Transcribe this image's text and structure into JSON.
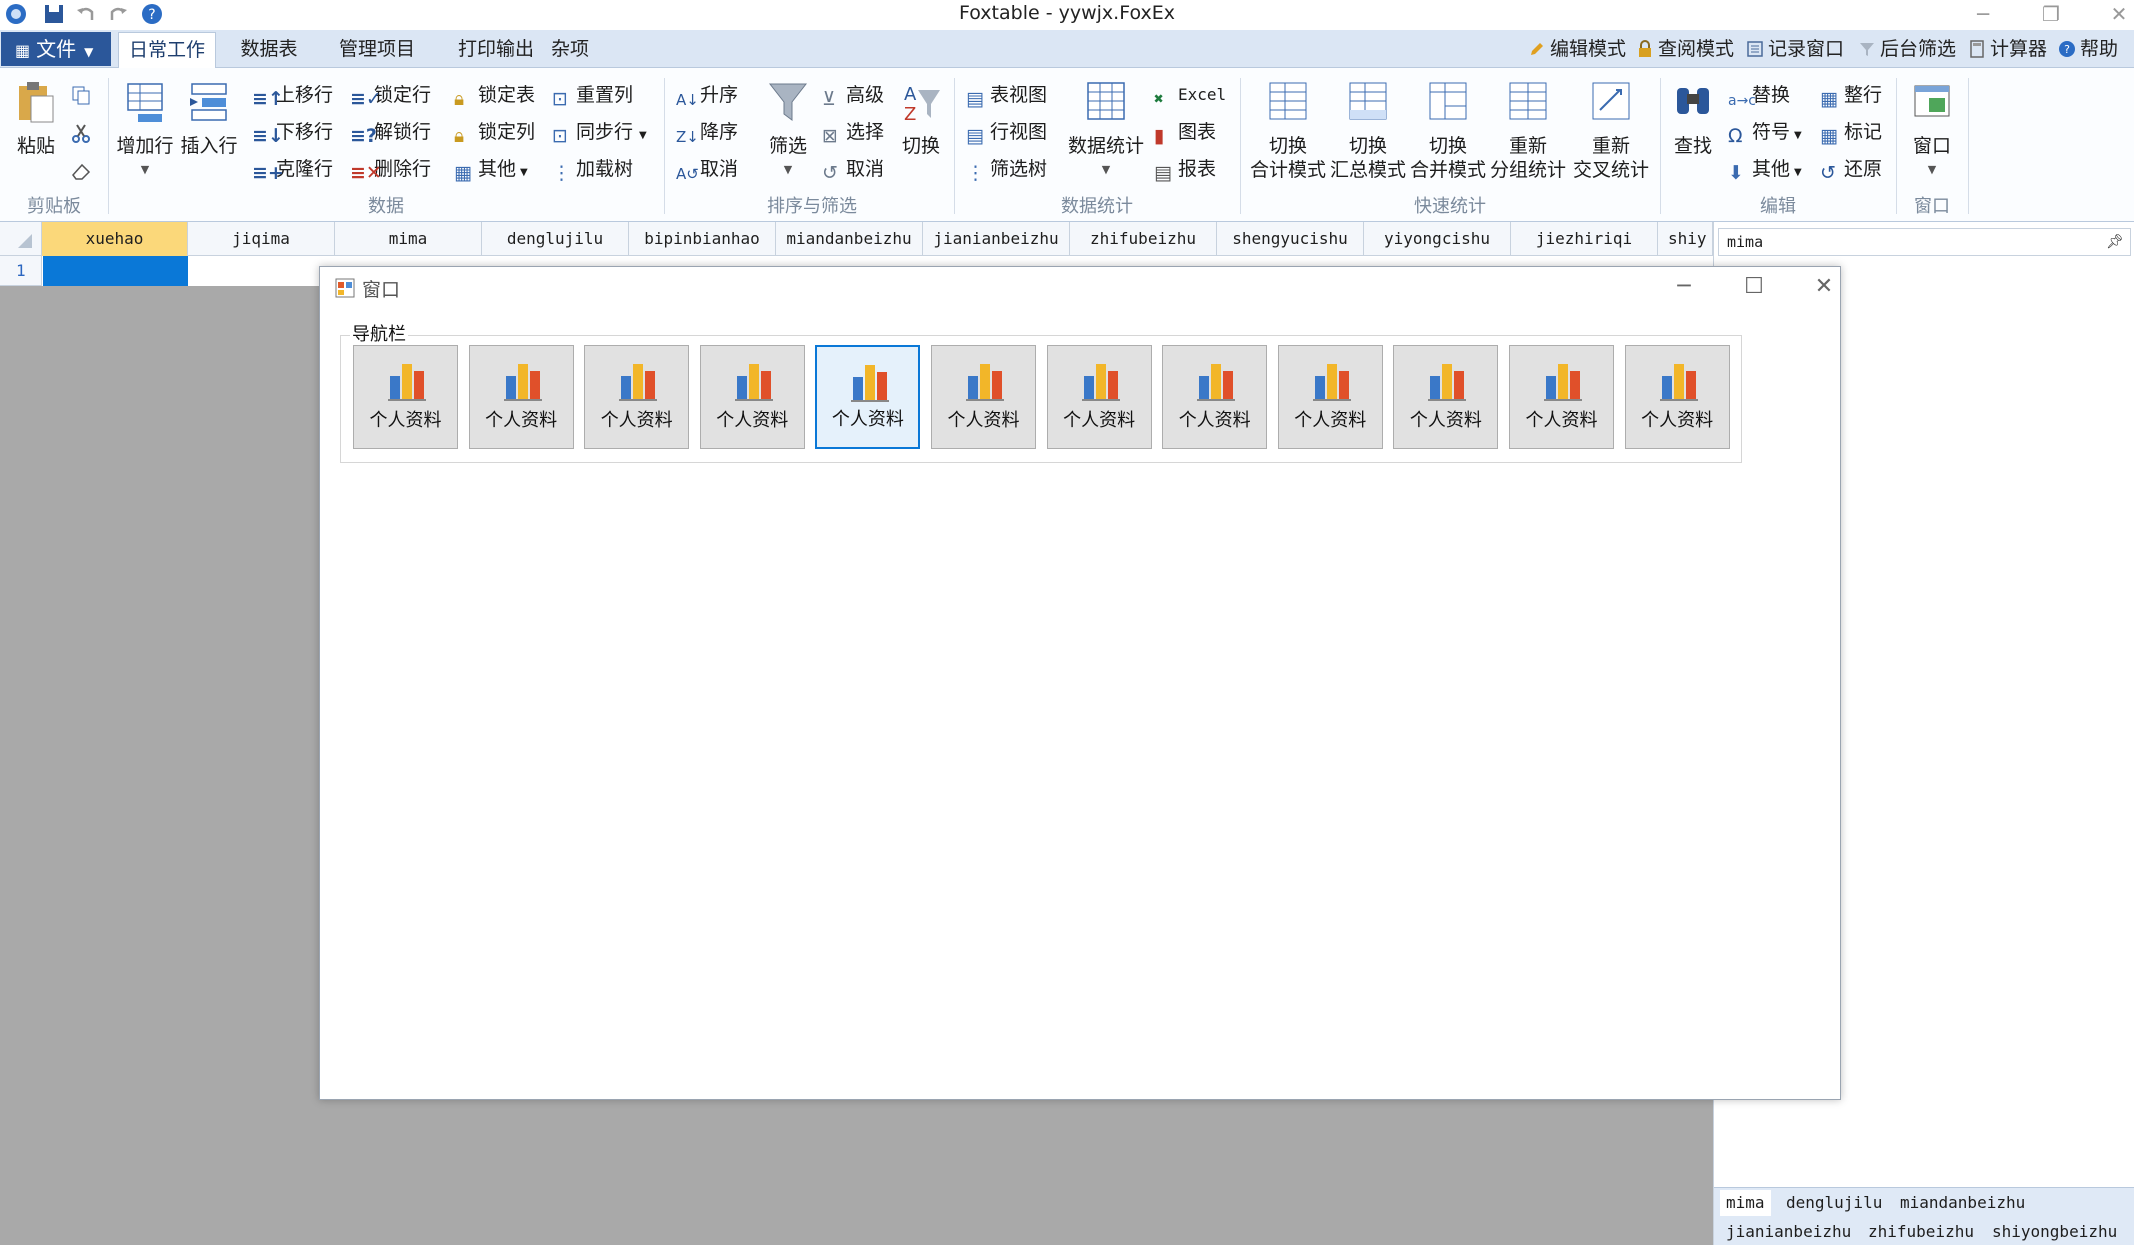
{
  "app": {
    "title": "Foxtable - yywjx.FoxEx"
  },
  "menu": {
    "file_label": "文件",
    "tabs": [
      "日常工作",
      "数据表",
      "管理项目",
      "打印输出",
      "杂项"
    ],
    "right_tools": [
      "编辑模式",
      "查阅模式",
      "记录窗口",
      "后台筛选",
      "计算器",
      "帮助"
    ]
  },
  "ribbon": {
    "clipboard": {
      "paste": "粘贴",
      "group": "剪贴板"
    },
    "data": {
      "add_row": "增加行",
      "insert_row": "插入行",
      "move_up": "上移行",
      "move_down": "下移行",
      "clone_row": "克隆行",
      "lock_row": "锁定行",
      "unlock_row": "解锁行",
      "delete_row": "删除行",
      "lock_table": "锁定表",
      "lock_col": "锁定列",
      "other": "其他",
      "reset_col": "重置列",
      "sync_row": "同步行",
      "load_tree": "加载树",
      "group": "数据"
    },
    "sort": {
      "asc": "升序",
      "desc": "降序",
      "cancel": "取消",
      "filter": "筛选",
      "advanced": "高级",
      "select": "选择",
      "cancel2": "取消",
      "switch": "切换",
      "group": "排序与筛选"
    },
    "views": {
      "table_view": "表视图",
      "row_view": "行视图",
      "filter_tree": "筛选树"
    },
    "stats": {
      "data_stats": "数据统计",
      "excel": "Excel",
      "chart": "图表",
      "report": "报表",
      "group": "数据统计"
    },
    "quick": {
      "b1": [
        "切换",
        "合计模式"
      ],
      "b2": [
        "切换",
        "汇总模式"
      ],
      "b3": [
        "切换",
        "合并模式"
      ],
      "b4": [
        "重新",
        "分组统计"
      ],
      "b5": [
        "重新",
        "交叉统计"
      ],
      "group": "快速统计"
    },
    "edit": {
      "find": "查找",
      "replace": "替换",
      "symbol": "符号",
      "other": "其他",
      "tidy": "整行",
      "mark": "标记",
      "restore": "还原",
      "group": "编辑"
    },
    "window": {
      "window": "窗口",
      "group": "窗口"
    }
  },
  "grid": {
    "columns": [
      "xuehao",
      "jiqima",
      "mima",
      "denglujilu",
      "bipinbianhao",
      "miandanbeizhu",
      "jianianbeizhu",
      "zhifubeizhu",
      "shengyucishu",
      "yiyongcishu",
      "jiezhiriqi",
      "shiy"
    ],
    "row_number": "1"
  },
  "right_panel": {
    "search_value": "mima",
    "tabs_row1": [
      "mima",
      "denglujilu",
      "miandanbeizhu"
    ],
    "tabs_row2": [
      "jianianbeizhu",
      "zhifubeizhu",
      "shiyongbeizhu"
    ]
  },
  "dialog": {
    "title": "窗口",
    "group_label": "导航栏",
    "buttons": [
      "个人资料",
      "个人资料",
      "个人资料",
      "个人资料",
      "个人资料",
      "个人资料",
      "个人资料",
      "个人资料",
      "个人资料",
      "个人资料",
      "个人资料",
      "个人资料"
    ],
    "focused_index": 4
  }
}
